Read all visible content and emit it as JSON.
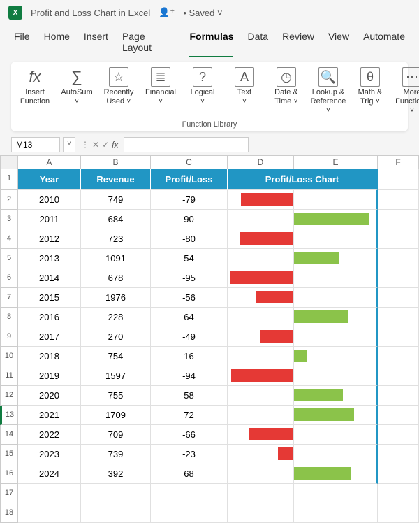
{
  "title": "Profit and Loss Chart in Excel",
  "save_status": "• Saved",
  "menu": {
    "file": "File",
    "home": "Home",
    "insert": "Insert",
    "page_layout": "Page Layout",
    "formulas": "Formulas",
    "data": "Data",
    "review": "Review",
    "view": "View",
    "automate": "Automate"
  },
  "active_tab": "formulas",
  "ribbon": {
    "insert_function": "Insert\nFunction",
    "autosum": "AutoSum",
    "recently_used": "Recently\nUsed",
    "financial": "Financial",
    "logical": "Logical",
    "text": "Text",
    "date_time": "Date &\nTime",
    "lookup_ref": "Lookup &\nReference",
    "math_trig": "Math &\nTrig",
    "more_functions": "More\nFunctions",
    "group_label": "Function Library"
  },
  "name_box": "M13",
  "columns": [
    "",
    "A",
    "B",
    "C",
    "D",
    "E",
    "F"
  ],
  "row_headers": [
    "1",
    "2",
    "3",
    "4",
    "5",
    "6",
    "7",
    "8",
    "9",
    "10",
    "11",
    "12",
    "13",
    "14",
    "15",
    "16",
    "17",
    "18"
  ],
  "selected_row": "13",
  "headers": {
    "year": "Year",
    "revenue": "Revenue",
    "pl": "Profit/Loss",
    "chart": "Profit/Loss Chart"
  },
  "chart_data": {
    "type": "bar",
    "title": "Profit/Loss Chart",
    "categories": [
      "2010",
      "2011",
      "2012",
      "2013",
      "2014",
      "2015",
      "2016",
      "2017",
      "2018",
      "2019",
      "2020",
      "2021",
      "2022",
      "2023",
      "2024"
    ],
    "series": [
      {
        "name": "Revenue",
        "values": [
          749,
          684,
          723,
          1091,
          678,
          1976,
          228,
          270,
          754,
          1597,
          755,
          1709,
          709,
          739,
          392
        ]
      },
      {
        "name": "Profit/Loss",
        "values": [
          -79,
          90,
          -80,
          54,
          -95,
          -56,
          64,
          -49,
          16,
          -94,
          58,
          72,
          -66,
          -23,
          68
        ]
      }
    ],
    "xlabel": "Year",
    "ylabel": "",
    "ylim": [
      -100,
      100
    ]
  }
}
